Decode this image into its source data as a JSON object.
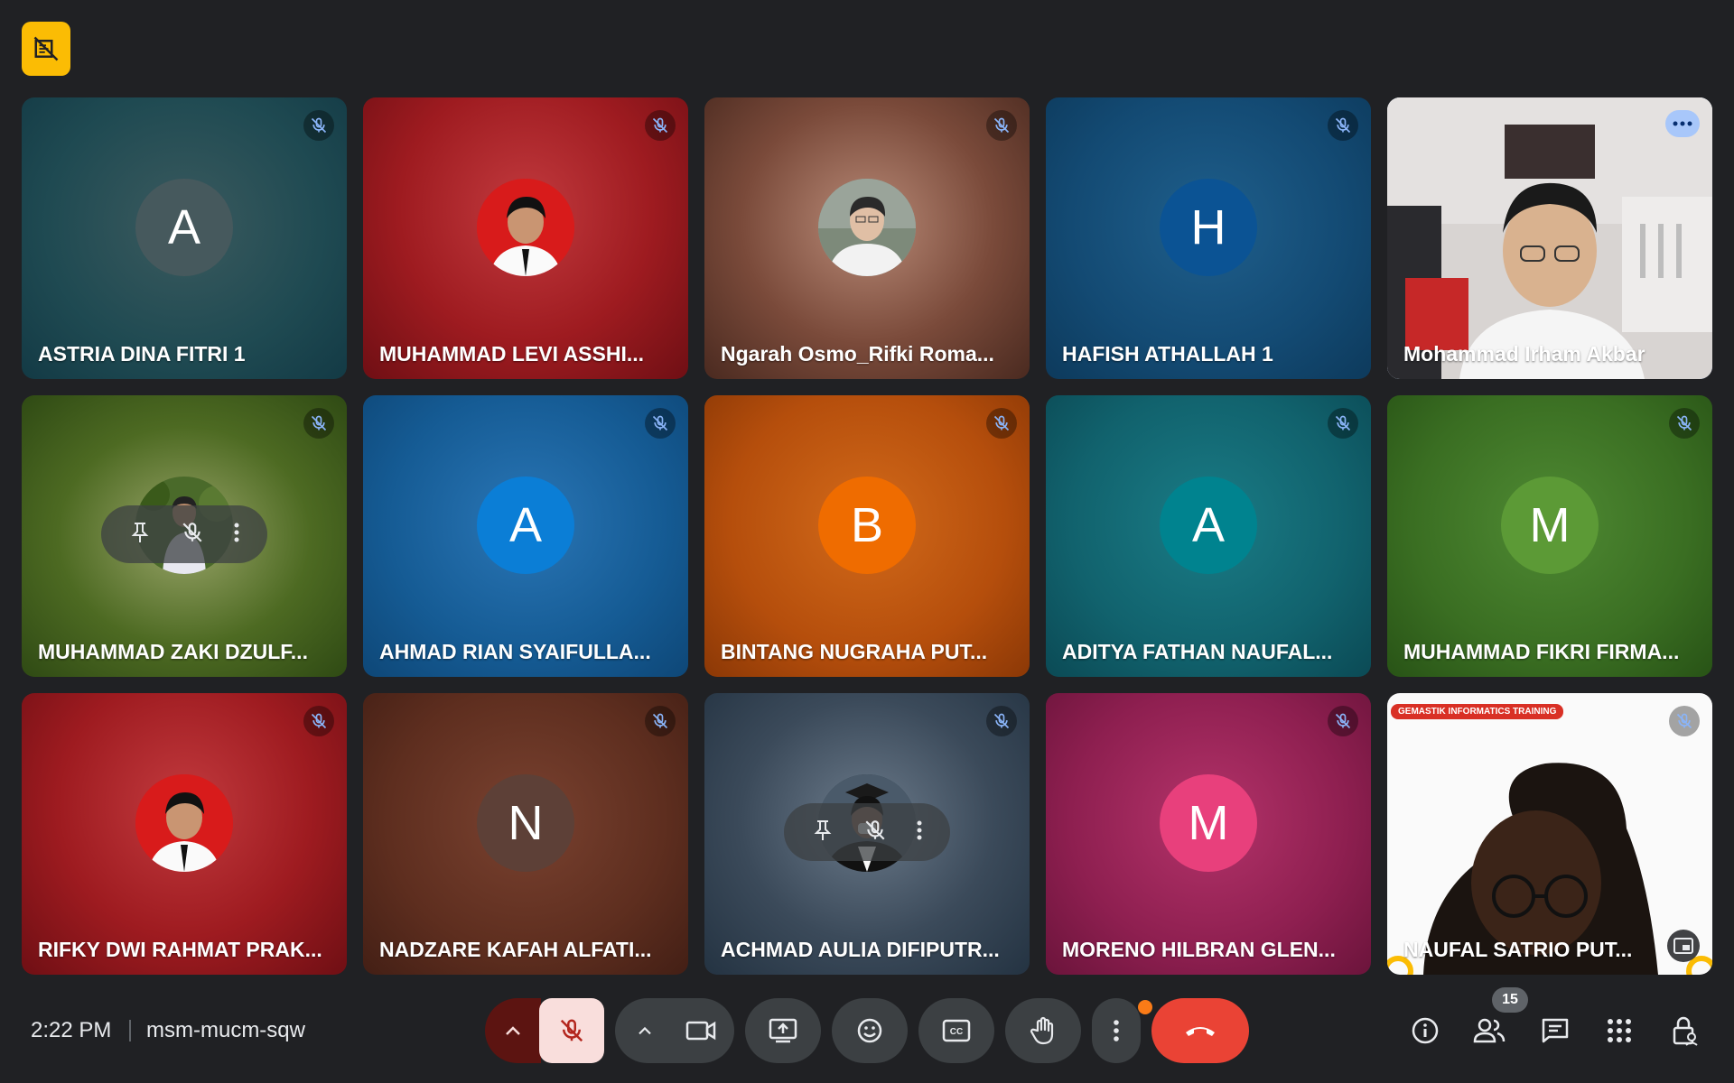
{
  "participants": [
    {
      "name": "ASTRIA DINA FITRI 1",
      "initial": "A",
      "bg": "radial-gradient(ellipse at 50% 45%, #3b5a5e 0%, #1f4a52 60%, #133a45 100%)",
      "avatar_color": "#46595d",
      "muted": true
    },
    {
      "name": "MUHAMMAD LEVI ASSHI...",
      "initial": "",
      "bg": "radial-gradient(ellipse at 50% 40%, #c23a3e 0%, #9e1b20 55%, #6f0f14 100%)",
      "avatar_color": "#d81b1b",
      "muted": true,
      "photo": "red-portrait"
    },
    {
      "name": "Ngarah Osmo_Rifki Roma...",
      "initial": "",
      "bg": "radial-gradient(ellipse at 50% 45%, #b88a77 0%, #7a4a3a 55%, #4a2a20 100%)",
      "avatar_color": "#9a9a9a",
      "muted": true,
      "photo": "grey-portrait"
    },
    {
      "name": "HAFISH ATHALLAH 1",
      "initial": "H",
      "bg": "radial-gradient(ellipse at 50% 45%, #1f5f8c 0%, #134a73 60%, #0d3a5c 100%)",
      "avatar_color": "#0b5394",
      "muted": true
    },
    {
      "name": "Mohammad Irham Akbar",
      "initial": "",
      "bg": "video-room",
      "muted": false,
      "active": true
    },
    {
      "name": "MUHAMMAD ZAKI DZULF...",
      "initial": "",
      "bg": "radial-gradient(ellipse at 50% 50%, #9aa56a 0%, #4d6a22 55%, #2f4a14 100%)",
      "avatar_color": "#6c7a4a",
      "muted": true,
      "photo": "green-portrait",
      "hover": true
    },
    {
      "name": "AHMAD RIAN SYAIFULLA...",
      "initial": "A",
      "bg": "radial-gradient(ellipse at 50% 45%, #2a76b6 0%, #155b94 60%, #0e4777 100%)",
      "avatar_color": "#0b7ed6",
      "muted": true
    },
    {
      "name": "BINTANG NUGRAHA PUT...",
      "initial": "B",
      "bg": "radial-gradient(ellipse at 50% 45%, #d26a1a 0%, #b54e0c 60%, #8b3806 100%)",
      "avatar_color": "#ef6c00",
      "muted": true
    },
    {
      "name": "ADITYA FATHAN NAUFAL...",
      "initial": "A",
      "bg": "radial-gradient(ellipse at 50% 45%, #1a7c86 0%, #11626d 60%, #0b4a55 100%)",
      "avatar_color": "#00838f",
      "muted": true
    },
    {
      "name": "MUHAMMAD FIKRI FIRMA...",
      "initial": "M",
      "bg": "radial-gradient(ellipse at 50% 45%, #4f8a33 0%, #3a6e22 60%, #285316 100%)",
      "avatar_color": "#5c9a36",
      "muted": true
    },
    {
      "name": "RIFKY DWI RAHMAT PRAK...",
      "initial": "",
      "bg": "radial-gradient(ellipse at 50% 40%, #c23a3e 0%, #9e1b20 55%, #6f0f14 100%)",
      "avatar_color": "#d81b1b",
      "muted": true,
      "photo": "red-portrait"
    },
    {
      "name": "NADZARE KAFAH ALFATI...",
      "initial": "N",
      "bg": "radial-gradient(ellipse at 50% 45%, #7a4230 0%, #5e2e1f 60%, #431f15 100%)",
      "avatar_color": "#5d4037",
      "muted": true
    },
    {
      "name": "ACHMAD AULIA DIFIPUTR...",
      "initial": "",
      "bg": "radial-gradient(ellipse at 50% 45%, #6b7a8a 0%, #3b4a5a 55%, #243342 100%)",
      "avatar_color": "#2f3b47",
      "muted": true,
      "photo": "dark-portrait",
      "hover": true
    },
    {
      "name": "MORENO HILBRAN GLEN...",
      "initial": "M",
      "bg": "radial-gradient(ellipse at 50% 45%, #b4336a 0%, #8e1f50 60%, #6b143b 100%)",
      "avatar_color": "#e8407c",
      "muted": true
    },
    {
      "name": "NAUFAL SATRIO PUT...",
      "initial": "",
      "bg": "video-white",
      "muted": true,
      "banner": "GEMASTIK INFORMATICS TRAINING"
    }
  ],
  "meeting": {
    "time": "2:22 PM",
    "code": "msm-mucm-sqw"
  },
  "people_count": "15",
  "colors": {
    "end_call": "#ea4335",
    "mic_off_bg": "#f9dedc",
    "mic_off_icon": "#b3261e",
    "mic_split": "#5c1411"
  }
}
